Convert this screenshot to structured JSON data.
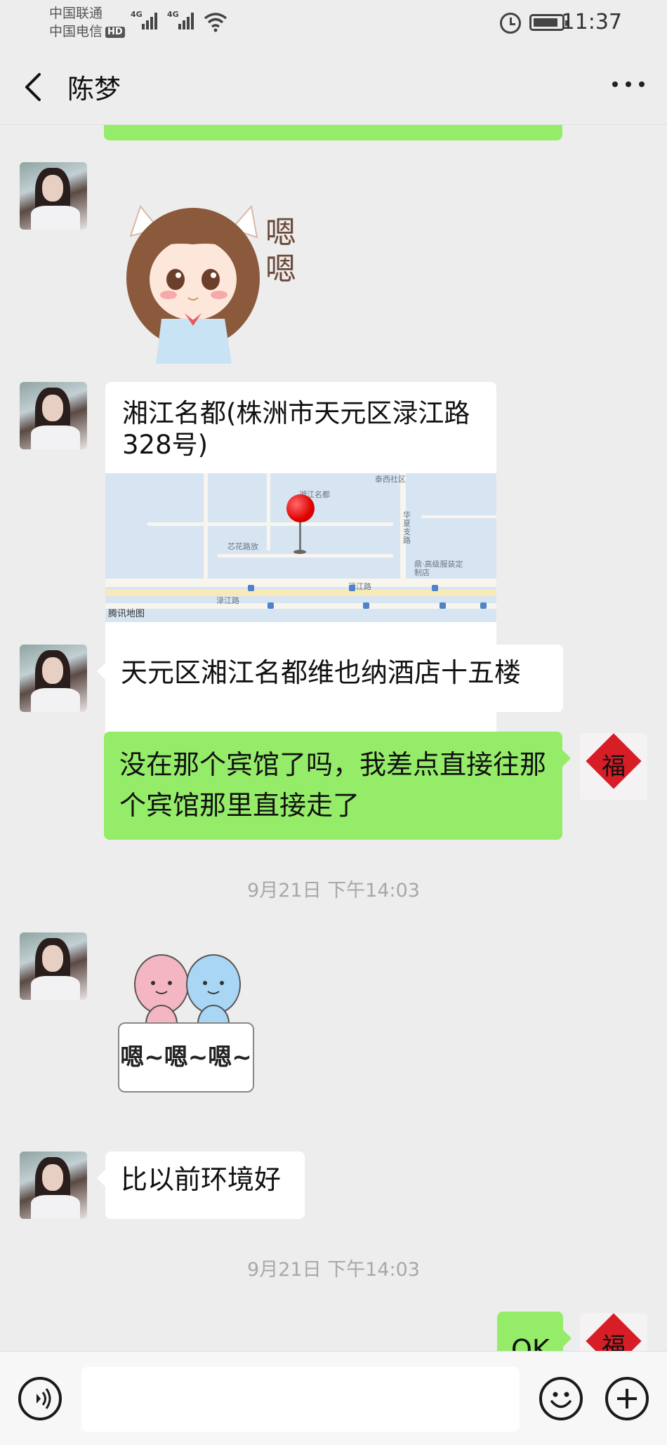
{
  "status_bar": {
    "carrier1": "中国联通",
    "carrier2": "中国电信",
    "hd": "HD",
    "network1": "4G",
    "network2": "4G",
    "time": "11:37"
  },
  "nav": {
    "title": "陈梦",
    "back_icon": "chevron-left-icon",
    "more_icon": "more-dots-icon"
  },
  "messages": [
    {
      "type": "location",
      "sender": "contact",
      "title": "湘江名都(株洲市天元区渌江路328号)",
      "map": {
        "labels": [
          "泰西社区",
          "湘江名都",
          "芯花路放",
          "华夏支路",
          "鼎·高级服装定制店",
          "渌江路",
          "渌江路"
        ],
        "provider": "腾讯地图"
      }
    },
    {
      "type": "text",
      "sender": "contact",
      "text": "天元区湘江名都维也纳酒店十五楼"
    },
    {
      "type": "text",
      "sender": "me",
      "text": "没在那个宾馆了吗，我差点直接往那个宾馆那里直接走了"
    },
    {
      "type": "time",
      "text": "9月21日 下午14:03"
    },
    {
      "type": "sticker",
      "sender": "contact",
      "caption": "嗯~嗯~嗯~"
    },
    {
      "type": "text",
      "sender": "contact",
      "text": "比以前环境好"
    },
    {
      "type": "time",
      "text": "9月21日 下午14:03"
    },
    {
      "type": "text",
      "sender": "me",
      "text": "OK"
    }
  ],
  "sticker_girl": {
    "caption": "嗯嗯"
  },
  "my_avatar": {
    "char": "福"
  },
  "colors": {
    "background": "#ededed",
    "incoming_bubble": "#ffffff",
    "outgoing_bubble": "#95ec69",
    "timestamp": "#a8a8a8"
  },
  "input_bar": {
    "voice_icon": "voice-icon",
    "emoji_icon": "emoji-icon",
    "plus_icon": "plus-icon"
  }
}
